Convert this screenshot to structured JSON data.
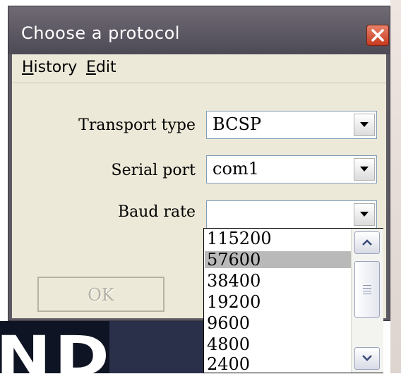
{
  "window": {
    "title": "Choose a protocol",
    "close_icon": "close-icon"
  },
  "menu": {
    "items": [
      {
        "label_ul": "H",
        "label_rest": "istory"
      },
      {
        "label_ul": "E",
        "label_rest": "dit"
      }
    ]
  },
  "form": {
    "transport_type": {
      "label": "Transport type",
      "value": "BCSP"
    },
    "serial_port": {
      "label": "Serial port",
      "value": "com1"
    },
    "baud_rate": {
      "label": "Baud rate",
      "value": ""
    }
  },
  "ok_button": {
    "label": "OK",
    "enabled": false
  },
  "baud_dropdown": {
    "options": [
      "115200",
      "57600",
      "38400",
      "19200",
      "9600",
      "4800",
      "2400"
    ],
    "highlighted": "57600"
  },
  "colors": {
    "titlebar": "#5e5a63",
    "close_button": "#d9502f",
    "highlight": "#b9b9b9"
  }
}
